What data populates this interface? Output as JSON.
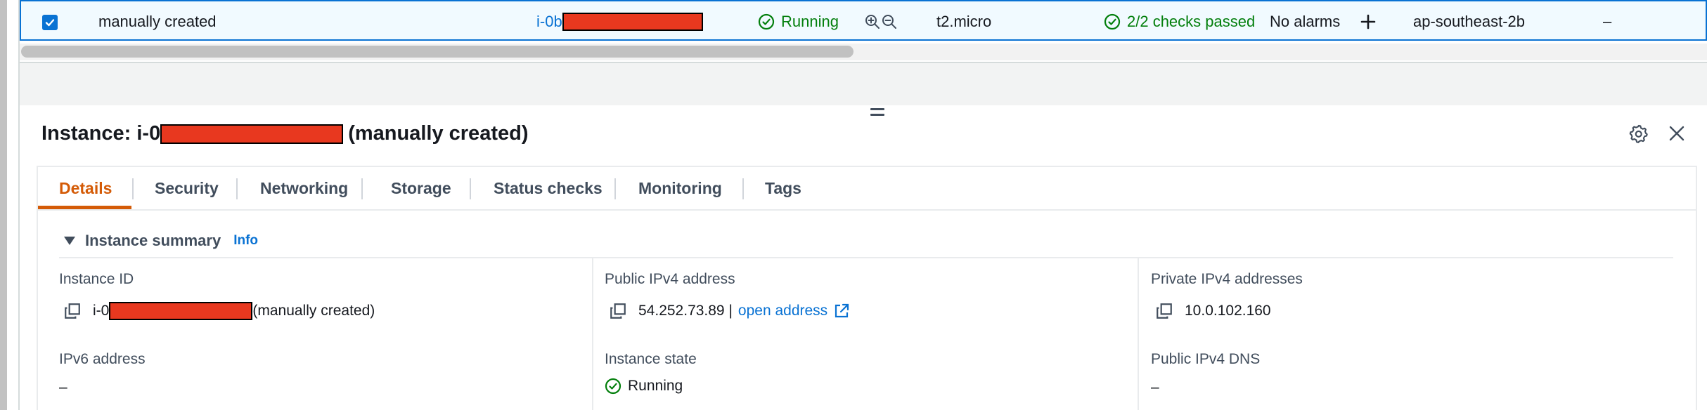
{
  "table_row": {
    "name": "manually created",
    "instance_id_prefix": "i-0b",
    "state": "Running",
    "instance_type": "t2.micro",
    "status_check": "2/2 checks passed",
    "alarm_status": "No alarms",
    "availability_zone": "ap-southeast-2b",
    "dash": "–"
  },
  "panel": {
    "title_prefix": "Instance: i-0",
    "title_suffix": "(manually created)"
  },
  "tabs": [
    {
      "label": "Details"
    },
    {
      "label": "Security"
    },
    {
      "label": "Networking"
    },
    {
      "label": "Storage"
    },
    {
      "label": "Status checks"
    },
    {
      "label": "Monitoring"
    },
    {
      "label": "Tags"
    }
  ],
  "summary": {
    "title": "Instance summary",
    "info": "Info"
  },
  "fields": {
    "instance_id": {
      "label": "Instance ID",
      "prefix": "i-0",
      "suffix": "(manually created)"
    },
    "public_ipv4": {
      "label": "Public IPv4 address",
      "value": "54.252.73.89 |",
      "link": "open address"
    },
    "private_ipv4": {
      "label": "Private IPv4 addresses",
      "value": "10.0.102.160"
    },
    "ipv6": {
      "label": "IPv6 address",
      "value": "–"
    },
    "instance_state": {
      "label": "Instance state",
      "value": "Running"
    },
    "public_dns": {
      "label": "Public IPv4 DNS",
      "value": "–"
    }
  },
  "colors": {
    "link": "#0972d3",
    "success": "#037f0c",
    "active_tab": "#d45b07",
    "redaction": "#e8381f"
  },
  "icons": [
    "checkbox-checked-icon",
    "status-check-icon",
    "zoom-in-icon",
    "zoom-out-icon",
    "plus-icon",
    "settings-gear-icon",
    "close-icon",
    "copy-icon",
    "external-link-icon"
  ]
}
